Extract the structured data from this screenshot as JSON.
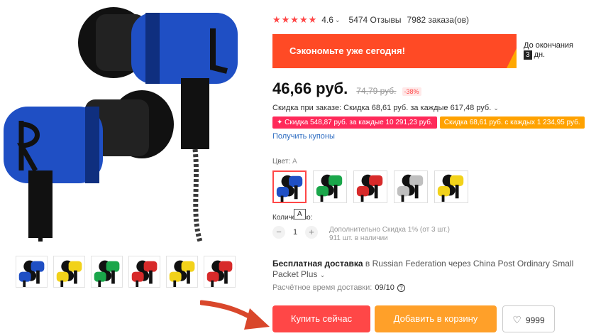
{
  "rating": {
    "stars": "★★★★★",
    "value": "4.6",
    "reviews": "5474 Отзывы",
    "orders": "7982 заказа(ов)"
  },
  "promo": {
    "text": "Сэкономьте уже сегодня!",
    "until_label": "До окончания",
    "days_number": "3",
    "days_suffix": "дн."
  },
  "price": {
    "current": "46,66 руб.",
    "old": "74,79 руб.",
    "discount": "-38%"
  },
  "order_discount": "Скидка при заказе: Скидка 68,61 руб. за каждые 617,48 руб.",
  "coupons": [
    {
      "text": "✦ Скидка 548,87 руб. за каждые 10 291,23 руб."
    },
    {
      "text": "Скидка 68,61 руб. с каждых 1 234,95 руб."
    }
  ],
  "get_coupons": "Получить купоны",
  "color": {
    "label": "Цвет:",
    "value": "A"
  },
  "variants": [
    {
      "accent": "#1f4fc4",
      "selected": true
    },
    {
      "accent": "#1aa64a",
      "selected": false
    },
    {
      "accent": "#d72a2a",
      "selected": false
    },
    {
      "accent": "#bfbfbf",
      "selected": false
    },
    {
      "accent": "#f2d21a",
      "selected": false
    }
  ],
  "thumbnails": [
    {
      "accent": "#1f4fc4"
    },
    {
      "accent": "#f2d21a"
    },
    {
      "accent": "#1aa64a"
    },
    {
      "accent": "#d72a2a"
    },
    {
      "accent": "#f2d21a"
    },
    {
      "accent": "#d72a2a"
    }
  ],
  "quantity": {
    "label": "Количество:",
    "tooltip": "A",
    "minus": "−",
    "plus": "+",
    "value": "1",
    "info_line1": "Дополнительно Скидка 1% (от 3 шт.)",
    "info_line2": "911 шт. в наличии"
  },
  "shipping": {
    "free": "Бесплатная доставка",
    "rest": "в Russian Federation через China Post Ordinary Small Packet Plus"
  },
  "delivery": {
    "label": "Расчётное время доставки:",
    "date": "09/10",
    "help": "?"
  },
  "buttons": {
    "buy": "Купить сейчас",
    "cart": "Добавить в корзину",
    "wishlist": "9999"
  },
  "colors": {
    "accent_red": "#ff4747",
    "promo_bg": "#ff4a25",
    "cart_orange": "#ffa029",
    "link_blue": "#2d6cc1"
  }
}
